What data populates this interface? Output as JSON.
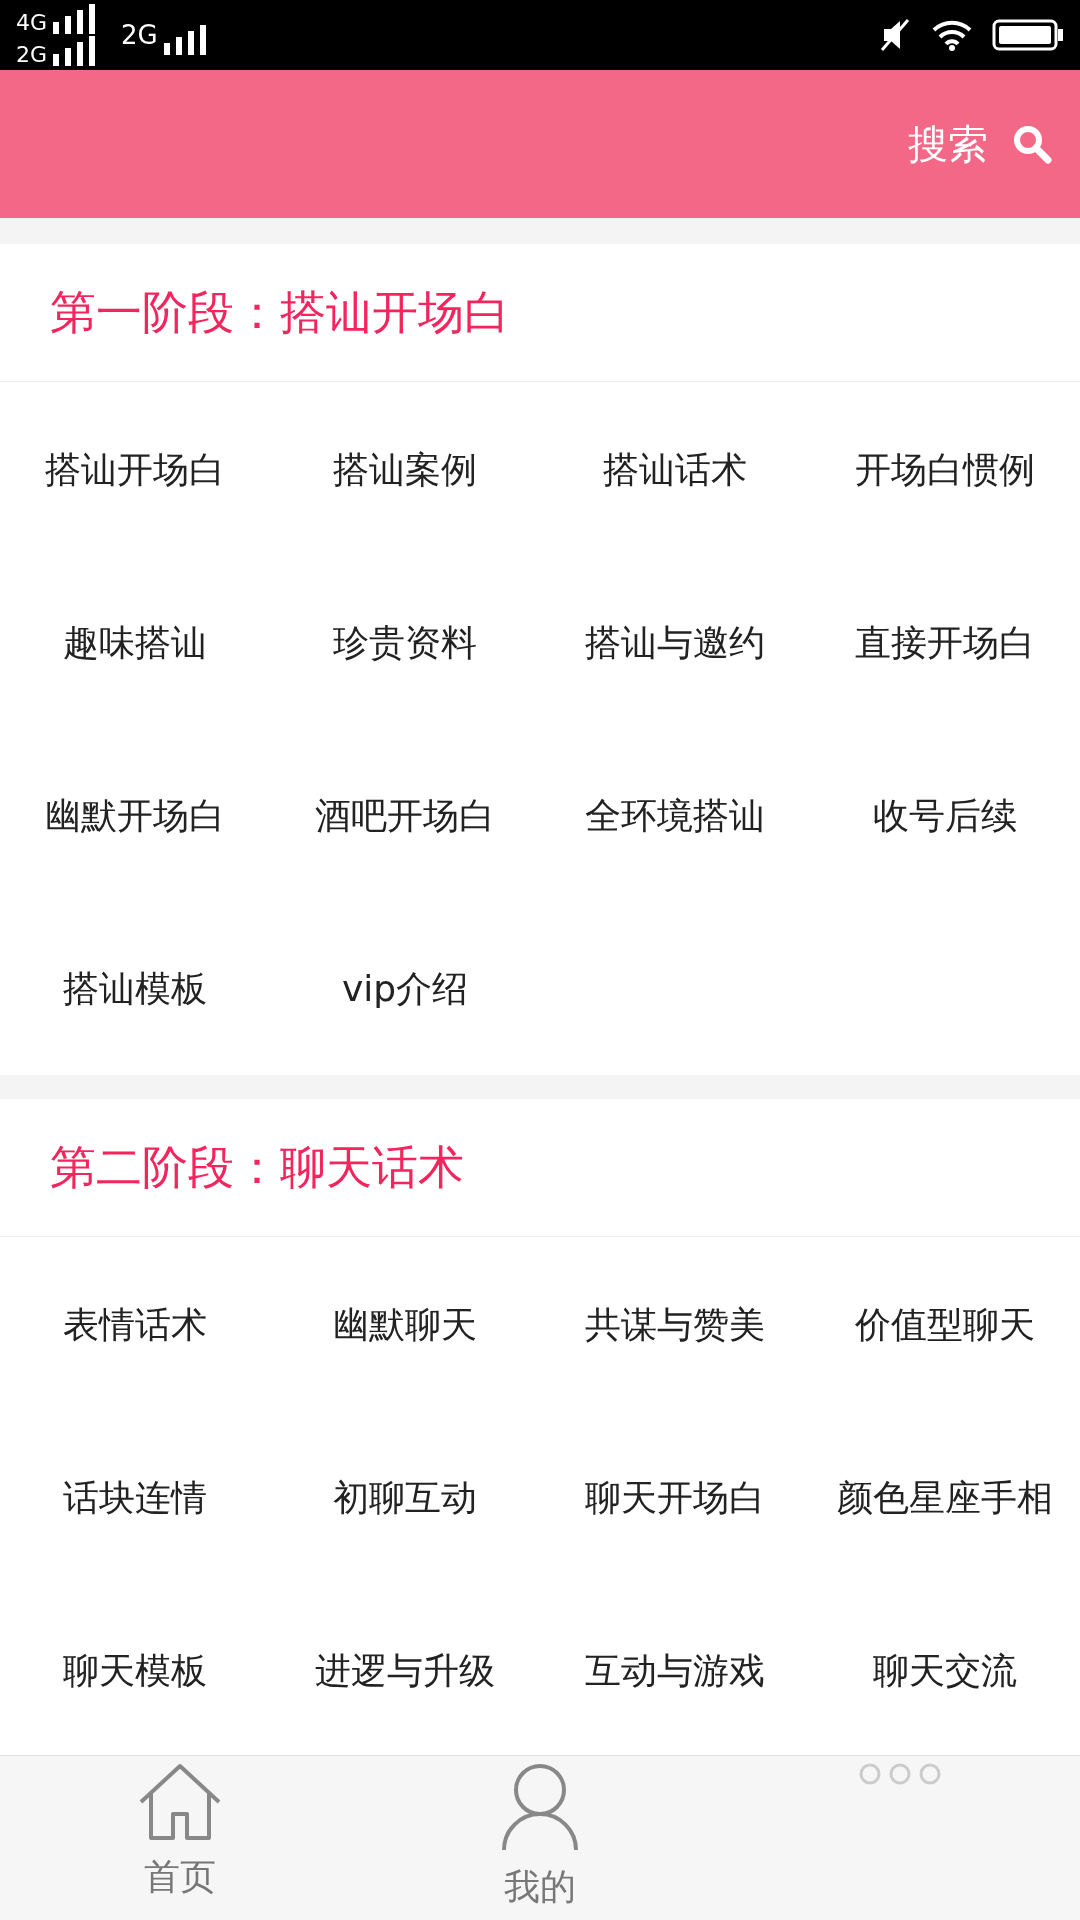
{
  "status_bar": {
    "network_1": "4G",
    "network_2": "2G",
    "network_3": "2G"
  },
  "header": {
    "search_label": "搜索"
  },
  "sections": [
    {
      "title": "第一阶段：搭讪开场白",
      "items": [
        "搭讪开场白",
        "搭讪案例",
        "搭讪话术",
        "开场白惯例",
        "趣味搭讪",
        "珍贵资料",
        "搭讪与邀约",
        "直接开场白",
        "幽默开场白",
        "酒吧开场白",
        "全环境搭讪",
        "收号后续",
        "搭讪模板",
        "vip介绍"
      ]
    },
    {
      "title": "第二阶段：聊天话术",
      "items": [
        "表情话术",
        "幽默聊天",
        "共谋与赞美",
        "价值型聊天",
        "话块连情",
        "初聊互动",
        "聊天开场白",
        "颜色星座手相",
        "聊天模板",
        "进逻与升级",
        "互动与游戏",
        "聊天交流"
      ]
    }
  ],
  "bottom_nav": [
    {
      "kind": "home",
      "label": "首页"
    },
    {
      "kind": "profile",
      "label": "我的"
    },
    {
      "kind": "more"
    }
  ]
}
